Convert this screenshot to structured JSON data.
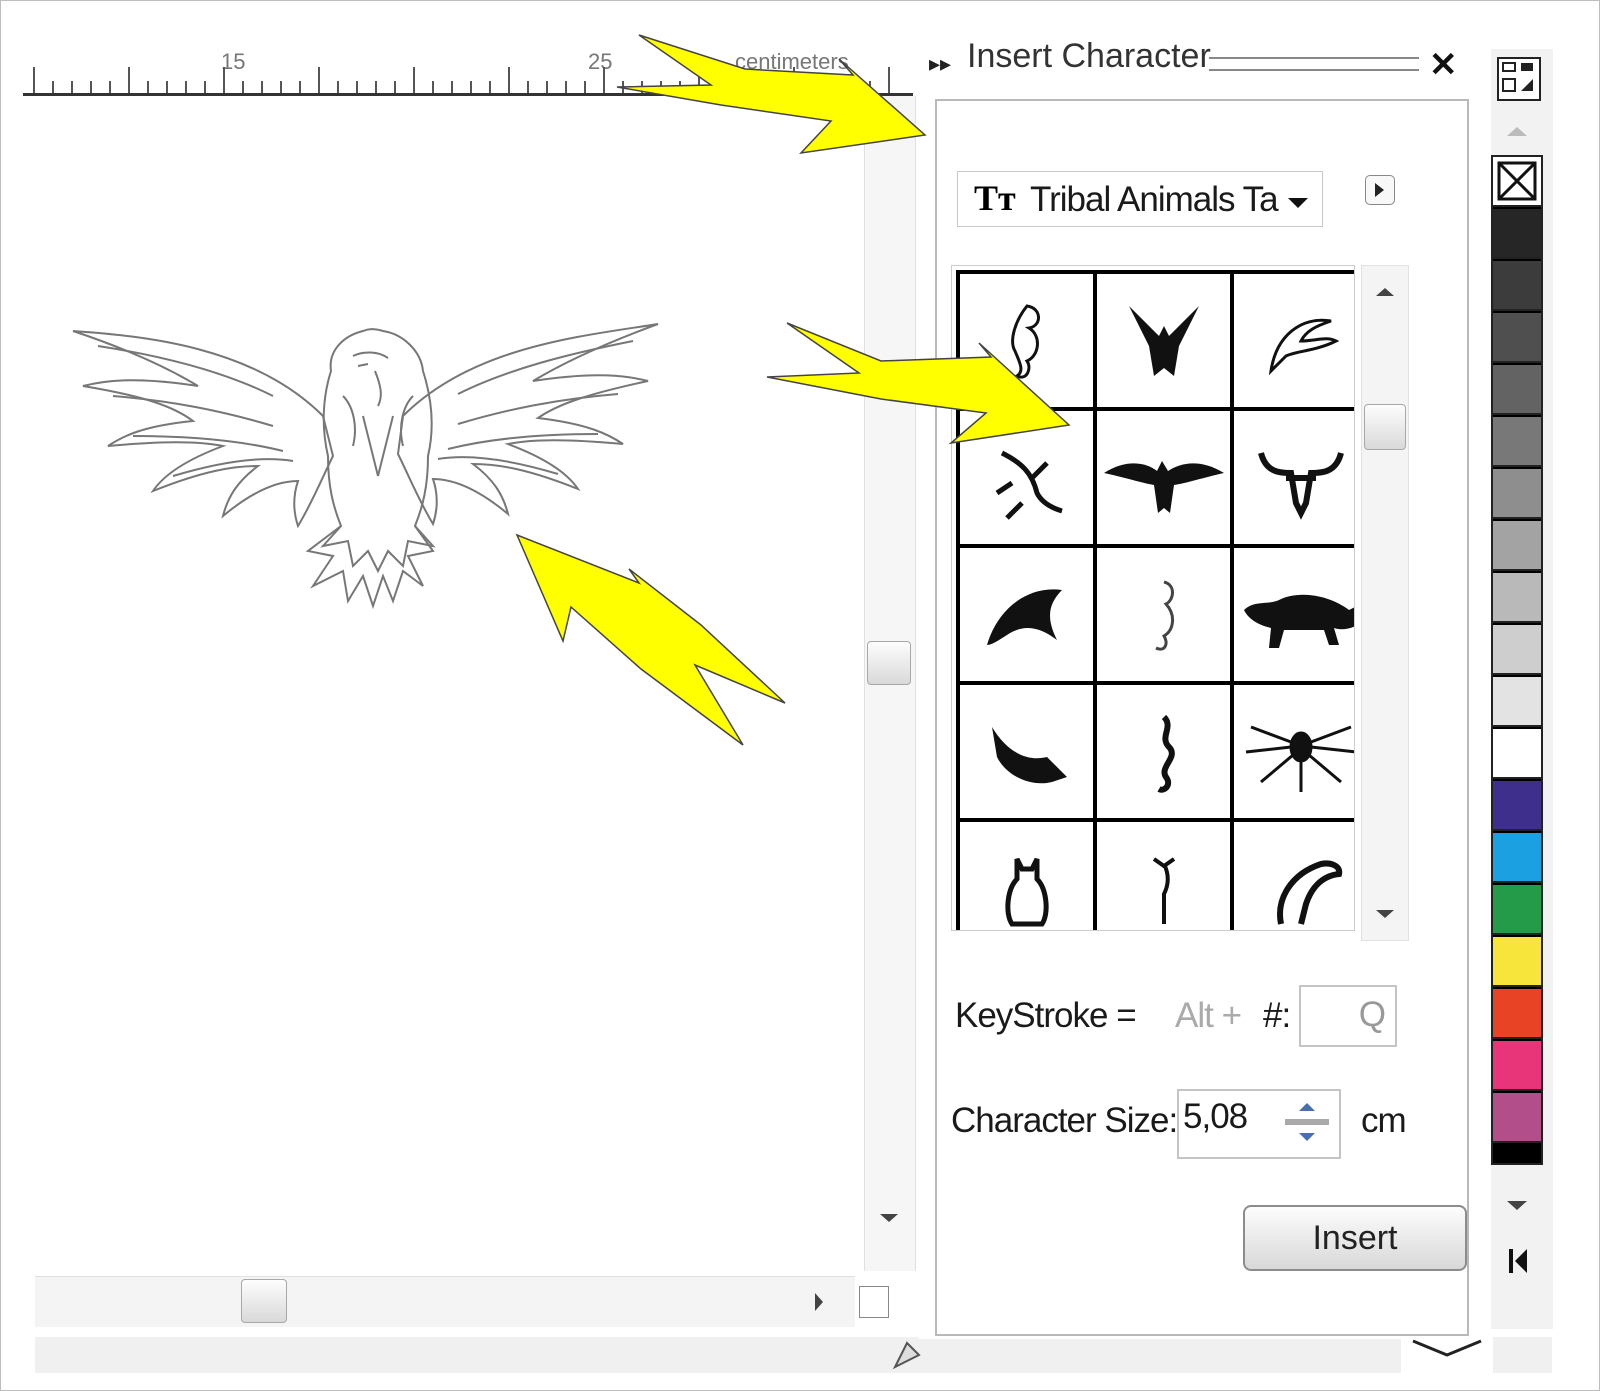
{
  "ruler": {
    "labels": [
      "15",
      "25",
      "centimeters"
    ]
  },
  "panel": {
    "title": "Insert Character",
    "font_name": "Tribal Animals Ta",
    "keystroke_label": "KeyStroke =",
    "alt_label": "Alt +",
    "hash_label": "#:",
    "keystroke_value": "Q",
    "size_label": "Character Size:",
    "size_value": "5,08",
    "unit": "cm",
    "insert_label": "Insert"
  },
  "glyphs": [
    {
      "name": "seahorse"
    },
    {
      "name": "eagle-perched"
    },
    {
      "name": "dolphin-leaping"
    },
    {
      "name": "lizard"
    },
    {
      "name": "eagle-spread"
    },
    {
      "name": "bull-head"
    },
    {
      "name": "dolphin"
    },
    {
      "name": "seahorse-small"
    },
    {
      "name": "bull"
    },
    {
      "name": "swallow"
    },
    {
      "name": "dragon"
    },
    {
      "name": "spider"
    },
    {
      "name": "cat"
    },
    {
      "name": "scorpion"
    },
    {
      "name": "panther"
    }
  ],
  "palette": {
    "colors": [
      "#262626",
      "#3c3c3c",
      "#4f4f4f",
      "#636363",
      "#787878",
      "#8e8e8e",
      "#a3a3a3",
      "#b9b9b9",
      "#cecece",
      "#e3e3e3",
      "#ffffff",
      "#3d2f8b",
      "#1ba1e2",
      "#239b48",
      "#f7e53b",
      "#e84324",
      "#e8357a",
      "#b24f8b"
    ]
  },
  "annotation_color": "#ffff00"
}
